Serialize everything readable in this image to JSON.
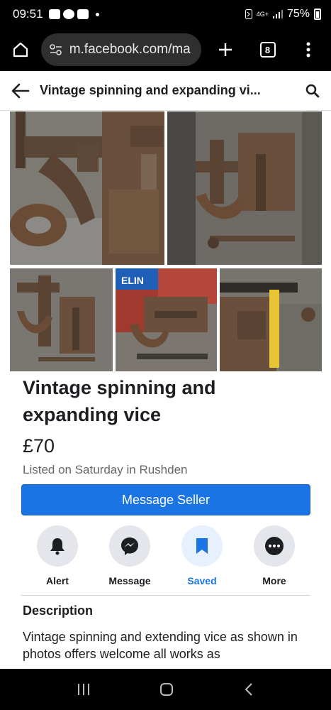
{
  "status": {
    "time": "09:51",
    "network": "4G+",
    "battery": "75%"
  },
  "browser": {
    "url": "m.facebook.com/ma",
    "tab_count": "8"
  },
  "header": {
    "title": "Vintage spinning and expanding vi..."
  },
  "listing": {
    "title": "Vintage spinning and expanding vice",
    "price": "£70",
    "listed": "Listed on Saturday in Rushden"
  },
  "photo_label": {
    "brand": "ELIN"
  },
  "buttons": {
    "message_seller": "Message Seller"
  },
  "actions": [
    {
      "label": "Alert",
      "icon": "bell-icon"
    },
    {
      "label": "Message",
      "icon": "messenger-icon"
    },
    {
      "label": "Saved",
      "icon": "bookmark-icon"
    },
    {
      "label": "More",
      "icon": "more-icon"
    }
  ],
  "description": {
    "heading": "Description",
    "text": "Vintage spinning and extending  vice as shown in photos offers welcome all works as"
  },
  "colors": {
    "accent": "#1b74e4",
    "saved_bg": "#e7f0fd"
  }
}
